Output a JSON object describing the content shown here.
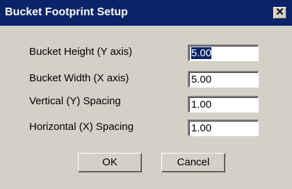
{
  "dialog": {
    "title": "Bucket Footprint Setup",
    "close_glyph": "✕"
  },
  "fields": [
    {
      "label": "Bucket Height (Y axis)",
      "value": "5.00",
      "selected": true
    },
    {
      "label": "Bucket Width (X axis)",
      "value": "5.00",
      "selected": false
    },
    {
      "label": "Vertical (Y) Spacing",
      "value": "1.00",
      "selected": false
    },
    {
      "label": "Horizontal (X) Spacing",
      "value": "1.00",
      "selected": false
    }
  ],
  "buttons": {
    "ok": "OK",
    "cancel": "Cancel"
  },
  "colors": {
    "titlebar": "#0a246a",
    "face": "#d4d0c8",
    "selection": "#0a246a"
  }
}
